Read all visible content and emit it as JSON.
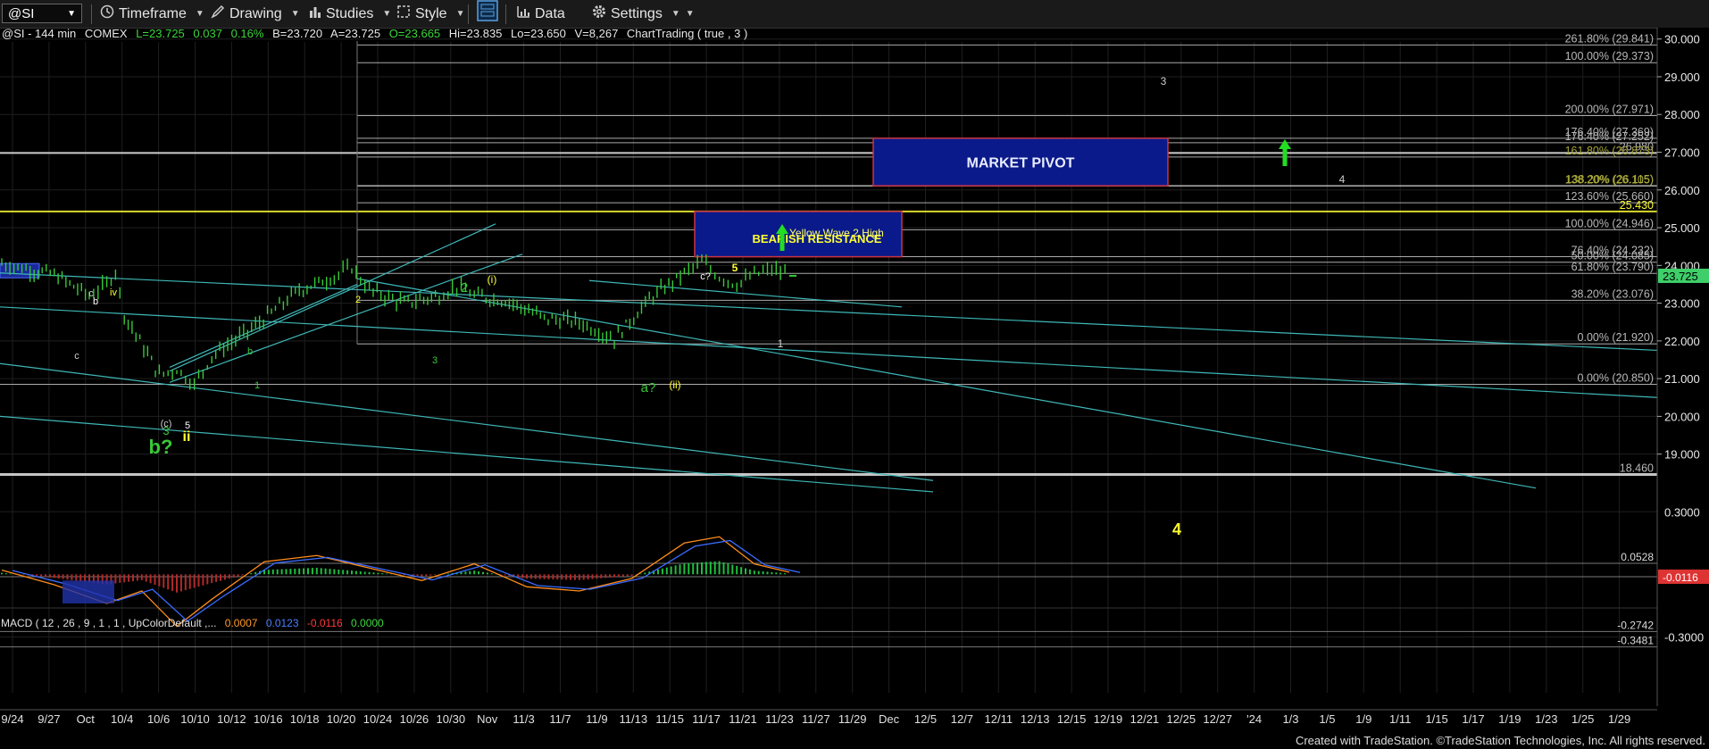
{
  "toolbar": {
    "symbol": "@SI",
    "timeframe": "Timeframe",
    "drawing": "Drawing",
    "studies": "Studies",
    "style": "Style",
    "data": "Data",
    "settings": "Settings"
  },
  "info_line": {
    "symbol": "@SI - 144 min",
    "exchange": "COMEX",
    "last": "L=23.725",
    "change": "0.037",
    "pct": "0.16%",
    "bid": "B=23.720",
    "ask": "A=23.725",
    "open": "O=23.665",
    "high": "Hi=23.835",
    "low": "Lo=23.650",
    "volume": "V=8,267",
    "study": "ChartTrading ( true , 3 )"
  },
  "macd_line": {
    "label": "MACD ( 12 , 26 , 9 , 1 , 1 , UpColorDefault ,...",
    "v1": "0.0007",
    "v2": "0.0123",
    "v3": "-0.0116",
    "v4": "0.0000"
  },
  "footer": "Created with TradeStation. ©TradeStation Technologies, Inc. All rights reserved.",
  "colors": {
    "bars": "#37c837",
    "teal": "#3fb7b7",
    "yellow": "#ffff33",
    "navy": "#0a1a8a",
    "pivot_border": "#cc3344",
    "grid": "#1f1f1f",
    "fib": "#c8c8c8"
  },
  "chart_data": {
    "type": "candlestick",
    "instrument": "@SI - 144 min",
    "ylim": [
      18.1,
      30.3
    ],
    "y_ticks": [
      "30.000",
      "29.000",
      "28.000",
      "27.000",
      "26.000",
      "25.000",
      "24.000",
      "23.000",
      "22.000",
      "21.000",
      "20.000",
      "19.000"
    ],
    "last_price": "23.725",
    "x_ticks": [
      "9/24",
      "9/27",
      "Oct",
      "10/4",
      "10/6",
      "10/10",
      "10/12",
      "10/16",
      "10/18",
      "10/20",
      "10/24",
      "10/26",
      "10/30",
      "Nov",
      "11/3",
      "11/7",
      "11/9",
      "11/13",
      "11/15",
      "11/17",
      "11/21",
      "11/23",
      "11/27",
      "11/29",
      "Dec",
      "12/5",
      "12/7",
      "12/11",
      "12/13",
      "12/15",
      "12/19",
      "12/21",
      "12/25",
      "12/27",
      "'24",
      "1/3",
      "1/5",
      "1/9",
      "1/11",
      "1/15",
      "1/17",
      "1/19",
      "1/23",
      "1/25",
      "1/29"
    ],
    "price_path": [
      [
        0,
        24.05
      ],
      [
        6,
        23.75
      ],
      [
        10,
        23.2
      ],
      [
        12,
        23.5
      ],
      [
        13,
        23.85
      ],
      [
        14,
        22.7
      ],
      [
        18,
        21.1
      ],
      [
        20,
        21.25
      ],
      [
        22,
        20.85
      ],
      [
        24,
        21.6
      ],
      [
        29,
        22.4
      ],
      [
        34,
        23.35
      ],
      [
        38,
        23.7
      ],
      [
        40,
        23.95
      ],
      [
        42,
        23.35
      ],
      [
        46,
        23.0
      ],
      [
        50,
        23.2
      ],
      [
        52,
        23.45
      ],
      [
        54,
        23.2
      ],
      [
        58,
        23.05
      ],
      [
        62,
        22.6
      ],
      [
        66,
        22.5
      ],
      [
        70,
        22.05
      ],
      [
        74,
        23.1
      ],
      [
        78,
        23.8
      ],
      [
        80,
        24.1
      ],
      [
        82,
        23.7
      ],
      [
        84,
        23.5
      ],
      [
        86,
        23.75
      ],
      [
        88,
        23.9
      ],
      [
        90,
        23.72
      ]
    ],
    "fib_levels": [
      {
        "label": "261.80% (29.841)",
        "value": 29.841
      },
      {
        "label": "100.00% (29.373)",
        "value": 29.373
      },
      {
        "label": "200.00% (27.971)",
        "value": 27.971
      },
      {
        "label": "176.40% (27.369)",
        "value": 27.369
      },
      {
        "label": "176.40% (27.252)",
        "value": 27.252
      },
      {
        "label": "26.980",
        "value": 26.98
      },
      {
        "label": "161.80% (26.873)",
        "value": 26.873
      },
      {
        "label": "138.20% (26.115)",
        "value": 26.115
      },
      {
        "label": "138.20% (26.105)",
        "value": 26.105
      },
      {
        "label": "123.60% (25.660)",
        "value": 25.66
      },
      {
        "label": "25.430",
        "value": 25.43
      },
      {
        "label": "100.00% (24.946)",
        "value": 24.946
      },
      {
        "label": "76.40% (24.232)",
        "value": 24.232
      },
      {
        "label": "50.00% (24.085)",
        "value": 24.085
      },
      {
        "label": "61.80% (23.790)",
        "value": 23.79
      },
      {
        "label": "38.20% (23.076)",
        "value": 23.076
      },
      {
        "label": "0.00% (21.920)",
        "value": 21.92
      },
      {
        "label": "0.00% (20.850)",
        "value": 20.85
      },
      {
        "label": "18.460",
        "value": 18.46
      }
    ],
    "zones": [
      {
        "label": "MARKET PIVOT",
        "top": 27.37,
        "bottom": 26.11
      },
      {
        "label": "BEARISH RESISTANCE",
        "top": 25.43,
        "bottom": 24.23
      }
    ],
    "annotations": [
      {
        "text": "Yellow Wave 2 High"
      },
      {
        "text": "3"
      },
      {
        "text": "4"
      },
      {
        "text": "4"
      },
      {
        "text": "5"
      },
      {
        "text": "c?"
      },
      {
        "text": "1"
      },
      {
        "text": "2"
      },
      {
        "text": "(i)"
      },
      {
        "text": "a?"
      },
      {
        "text": "(ii)"
      },
      {
        "text": "b?"
      },
      {
        "text": "ii"
      },
      {
        "text": "3"
      },
      {
        "text": "(c)"
      },
      {
        "text": "5"
      },
      {
        "text": "c"
      },
      {
        "text": "iv"
      },
      {
        "text": "b"
      },
      {
        "text": "c"
      },
      {
        "text": "b"
      },
      {
        "text": "1"
      },
      {
        "text": "2"
      },
      {
        "text": "3"
      },
      {
        "text": "4"
      }
    ],
    "macd": {
      "ylim": [
        -0.42,
        0.42
      ],
      "y_ticks": [
        "0.3000",
        "-0.3000"
      ],
      "levels": [
        {
          "label": "0.0528",
          "value": 0.0528
        },
        {
          "label": "-0.0116",
          "value": -0.0116
        },
        {
          "label": "-0.2742",
          "value": -0.2742
        },
        {
          "label": "-0.3481",
          "value": -0.3481
        }
      ]
    }
  }
}
